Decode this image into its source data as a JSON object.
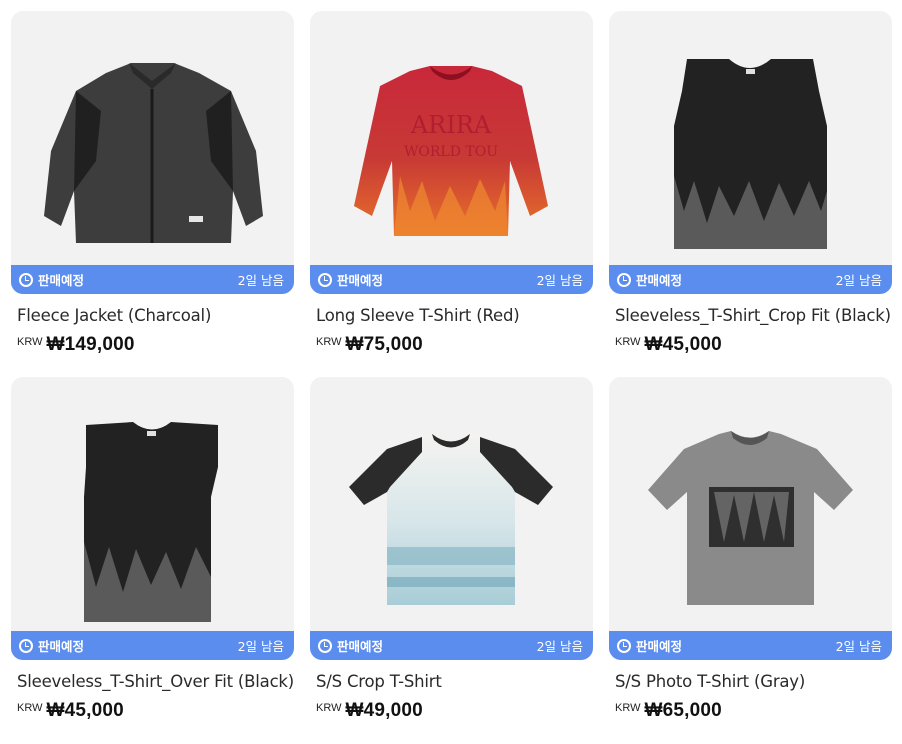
{
  "products": [
    {
      "name": "Fleece Jacket (Charcoal)",
      "currency": "KRW",
      "price": "₩149,000",
      "status": "판매예정",
      "remaining": "2일 남음",
      "image": "fleece-jacket-charcoal"
    },
    {
      "name": "Long Sleeve T-Shirt (Red)",
      "currency": "KRW",
      "price": "₩75,000",
      "status": "판매예정",
      "remaining": "2일 남음",
      "image": "long-sleeve-red"
    },
    {
      "name": "Sleeveless_T-Shirt_Crop Fit (Black)",
      "currency": "KRW",
      "price": "₩45,000",
      "status": "판매예정",
      "remaining": "2일 남음",
      "image": "sleeveless-crop-black"
    },
    {
      "name": "Sleeveless_T-Shirt_Over Fit (Black)",
      "currency": "KRW",
      "price": "₩45,000",
      "status": "판매예정",
      "remaining": "2일 남음",
      "image": "sleeveless-over-black"
    },
    {
      "name": "S/S Crop T-Shirt",
      "currency": "KRW",
      "price": "₩49,000",
      "status": "판매예정",
      "remaining": "2일 남음",
      "image": "ss-crop-tshirt"
    },
    {
      "name": "S/S Photo T-Shirt (Gray)",
      "currency": "KRW",
      "price": "₩65,000",
      "status": "판매예정",
      "remaining": "2일 남음",
      "image": "ss-photo-gray"
    }
  ],
  "colors": {
    "badge": "#5b8def",
    "card_bg": "#f2f2f2"
  }
}
